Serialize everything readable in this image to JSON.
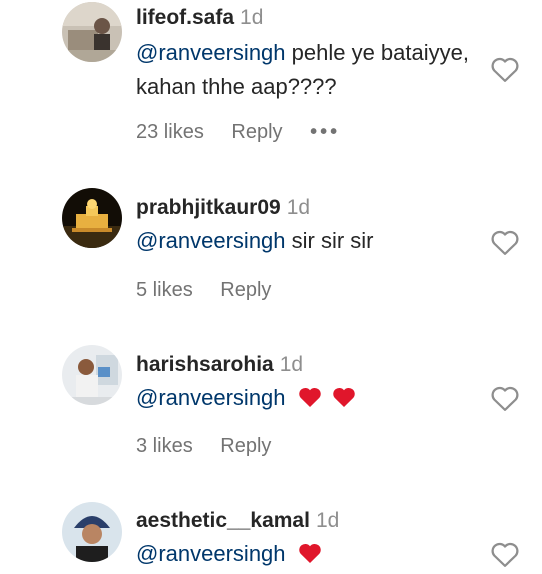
{
  "comments": [
    {
      "username": "lifeof.safa",
      "time": "1d",
      "mention": "@ranveersingh",
      "text": " pehle ye bataiyye, kahan thhe aap????",
      "likes": "23 likes",
      "reply": "Reply",
      "more": "•••"
    },
    {
      "username": "prabhjitkaur09",
      "time": "1d",
      "mention": "@ranveersingh",
      "text": " sir sir sir",
      "likes": "5 likes",
      "reply": "Reply"
    },
    {
      "username": "harishsarohia",
      "time": "1d",
      "mention": "@ranveersingh",
      "likes": "3 likes",
      "reply": "Reply"
    },
    {
      "username": "aesthetic__kamal",
      "time": "1d",
      "mention": "@ranveersingh"
    }
  ],
  "icons": {
    "like": "heart-outline-icon",
    "emoji": "red-heart-emoji",
    "more": "more-horizontal-icon"
  },
  "colors": {
    "mention": "#00376b",
    "meta": "#737373",
    "timestamp": "#8e8e8e",
    "emoji_heart": "#e0162b"
  }
}
